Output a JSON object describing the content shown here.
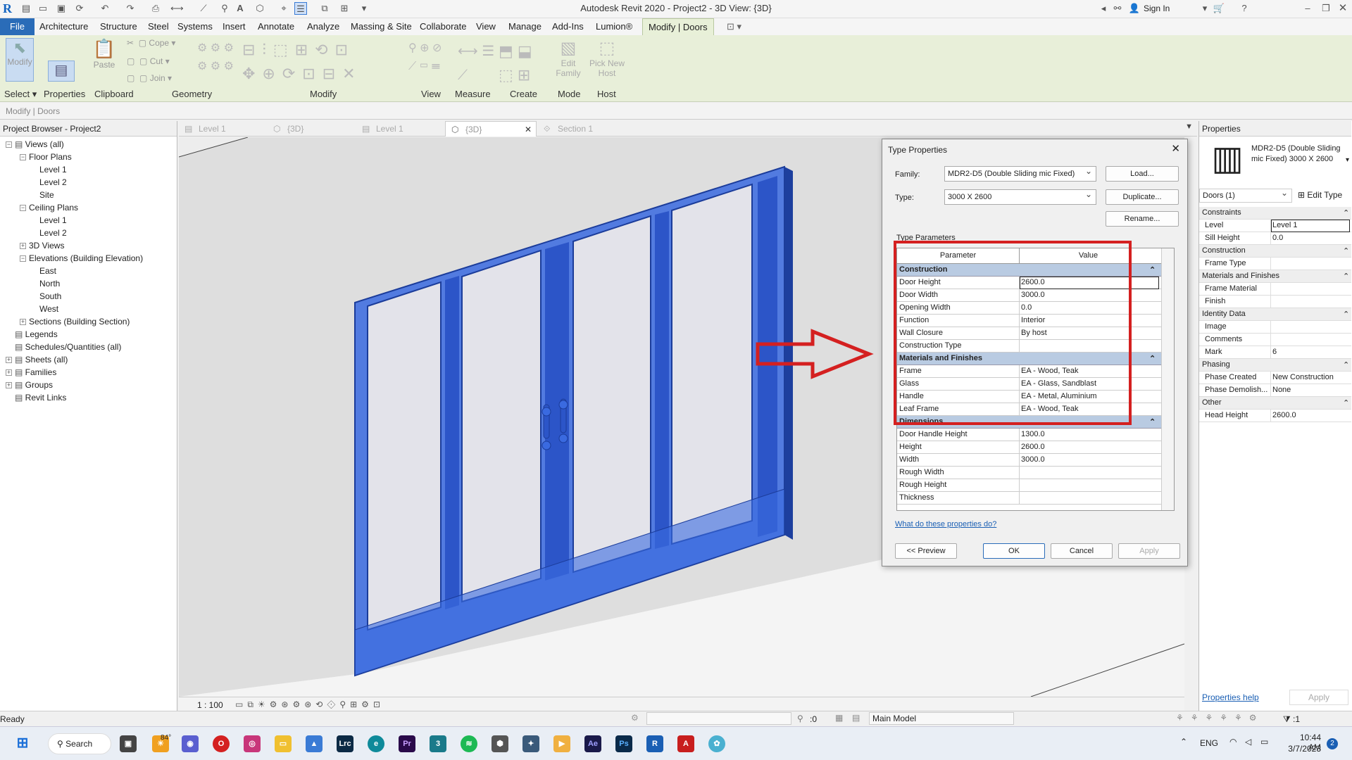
{
  "window": {
    "title": "Autodesk Revit 2020 - Project2 - 3D View: {3D}",
    "sign_in": "Sign In"
  },
  "ribbon": {
    "tabs": [
      "File",
      "Architecture",
      "Structure",
      "Steel",
      "Systems",
      "Insert",
      "Annotate",
      "Analyze",
      "Massing & Site",
      "Collaborate",
      "View",
      "Manage",
      "Add-Ins",
      "Lumion®",
      "Modify | Doors"
    ],
    "buttons": {
      "modify": "Modify",
      "paste": "Paste",
      "cope": "Cope",
      "cut": "Cut",
      "join": "Join",
      "edit_family": "Edit Family",
      "pick_new_host": "Pick New Host"
    },
    "panels": [
      "Select",
      "Properties",
      "Clipboard",
      "Geometry",
      "Modify",
      "View",
      "Measure",
      "Create",
      "Mode",
      "Host"
    ]
  },
  "context_bar": "Modify | Doors",
  "project_browser": {
    "title": "Project Browser - Project2",
    "items": [
      {
        "label": "Views (all)",
        "level": 0,
        "toggle": "−",
        "icon": true
      },
      {
        "label": "Floor Plans",
        "level": 1,
        "toggle": "−"
      },
      {
        "label": "Level 1",
        "level": 2
      },
      {
        "label": "Level 2",
        "level": 2
      },
      {
        "label": "Site",
        "level": 2
      },
      {
        "label": "Ceiling Plans",
        "level": 1,
        "toggle": "−"
      },
      {
        "label": "Level 1",
        "level": 2
      },
      {
        "label": "Level 2",
        "level": 2
      },
      {
        "label": "3D Views",
        "level": 1,
        "toggle": "+"
      },
      {
        "label": "Elevations (Building Elevation)",
        "level": 1,
        "toggle": "−"
      },
      {
        "label": "East",
        "level": 2
      },
      {
        "label": "North",
        "level": 2
      },
      {
        "label": "South",
        "level": 2
      },
      {
        "label": "West",
        "level": 2
      },
      {
        "label": "Sections (Building Section)",
        "level": 1,
        "toggle": "+"
      },
      {
        "label": "Legends",
        "level": 0,
        "icon": true
      },
      {
        "label": "Schedules/Quantities (all)",
        "level": 0,
        "icon": true
      },
      {
        "label": "Sheets (all)",
        "level": 0,
        "toggle": "+",
        "icon": true
      },
      {
        "label": "Families",
        "level": 0,
        "toggle": "+",
        "icon": true
      },
      {
        "label": "Groups",
        "level": 0,
        "toggle": "+",
        "icon": true
      },
      {
        "label": "Revit Links",
        "level": 0,
        "icon": true
      }
    ]
  },
  "view_tabs": [
    {
      "label": "Level 1",
      "active": false
    },
    {
      "label": "{3D}",
      "active": false
    },
    {
      "label": "Level 1",
      "active": false
    },
    {
      "label": "{3D}",
      "active": true
    },
    {
      "label": "Section 1",
      "active": false
    }
  ],
  "view_scale": "1 : 100",
  "type_properties": {
    "title": "Type Properties",
    "family_label": "Family:",
    "family_value": "MDR2-D5 (Double Sliding mic Fixed)",
    "type_label": "Type:",
    "type_value": "3000 X 2600",
    "load": "Load...",
    "duplicate": "Duplicate...",
    "rename": "Rename...",
    "type_parameters": "Type Parameters",
    "col_parameter": "Parameter",
    "col_value": "Value",
    "groups": [
      {
        "name": "Construction",
        "rows": [
          [
            "Door Height",
            "2600.0"
          ],
          [
            "Door Width",
            "3000.0"
          ],
          [
            "Opening Width",
            "0.0"
          ],
          [
            "Function",
            "Interior"
          ],
          [
            "Wall Closure",
            "By host"
          ],
          [
            "Construction Type",
            ""
          ]
        ]
      },
      {
        "name": "Materials and Finishes",
        "rows": [
          [
            "Frame",
            "EA - Wood, Teak"
          ],
          [
            "Glass",
            "EA - Glass, Sandblast"
          ],
          [
            "Handle",
            "EA - Metal, Aluminium"
          ],
          [
            "Leaf Frame",
            "EA - Wood, Teak"
          ]
        ]
      },
      {
        "name": "Dimensions",
        "rows": [
          [
            "Door Handle Height",
            "1300.0"
          ],
          [
            "Height",
            "2600.0"
          ],
          [
            "Width",
            "3000.0"
          ],
          [
            "Rough Width",
            ""
          ],
          [
            "Rough Height",
            ""
          ],
          [
            "Thickness",
            ""
          ]
        ]
      }
    ],
    "help_link": "What do these properties do?",
    "preview": "<< Preview",
    "ok": "OK",
    "cancel": "Cancel",
    "apply": "Apply"
  },
  "properties": {
    "title": "Properties",
    "type_name": "MDR2-D5 (Double Sliding mic Fixed) 3000 X 2600",
    "instance_selector": "Doors (1)",
    "edit_type": "Edit Type",
    "groups": [
      {
        "name": "Constraints",
        "rows": [
          [
            "Level",
            "Level 1"
          ],
          [
            "Sill Height",
            "0.0"
          ]
        ]
      },
      {
        "name": "Construction",
        "rows": [
          [
            "Frame Type",
            ""
          ]
        ]
      },
      {
        "name": "Materials and Finishes",
        "rows": [
          [
            "Frame Material",
            ""
          ],
          [
            "Finish",
            ""
          ]
        ]
      },
      {
        "name": "Identity Data",
        "rows": [
          [
            "Image",
            ""
          ],
          [
            "Comments",
            ""
          ],
          [
            "Mark",
            "6"
          ]
        ]
      },
      {
        "name": "Phasing",
        "rows": [
          [
            "Phase Created",
            "New Construction"
          ],
          [
            "Phase Demolish...",
            "None"
          ]
        ]
      },
      {
        "name": "Other",
        "rows": [
          [
            "Head Height",
            "2600.0"
          ]
        ]
      }
    ],
    "help_link": "Properties help",
    "apply": "Apply"
  },
  "status": {
    "text": "Ready",
    "count": ":0",
    "model": "Main Model",
    "filter": ":1"
  },
  "taskbar": {
    "search": "Search",
    "weather": "84°",
    "lang": "ENG",
    "time": "10:44 AM",
    "date": "3/7/2023",
    "notif": "2"
  },
  "colors": {
    "door_blue": "#2f5fd0",
    "highlight_red": "#d42020",
    "ribbon_green": "#e8efd9"
  }
}
